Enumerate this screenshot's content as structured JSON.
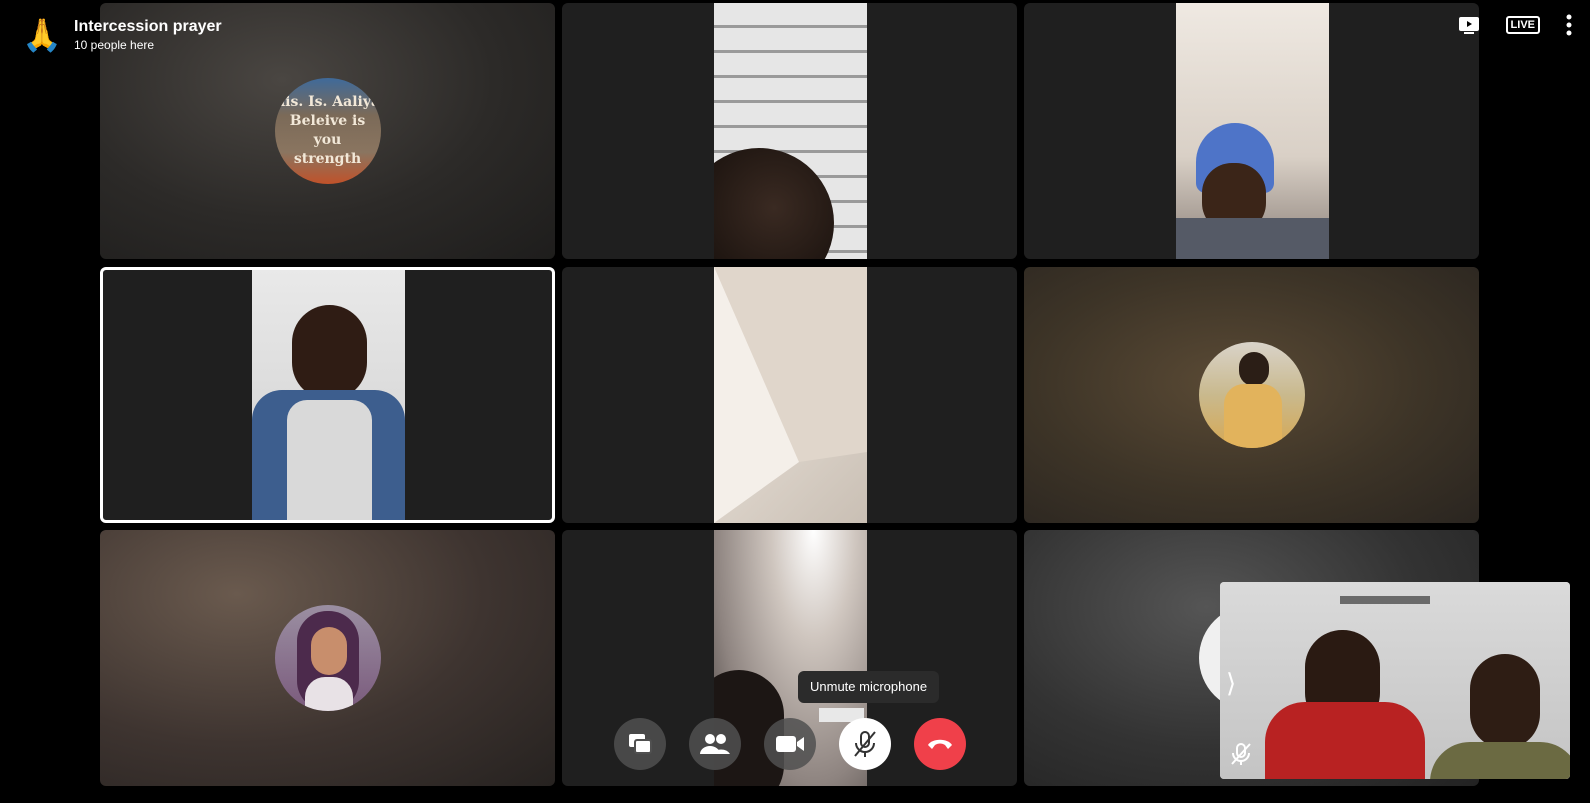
{
  "room": {
    "emoji": "🙏",
    "title": "Intercession prayer",
    "subtitle": "10 people here"
  },
  "top_bar": {
    "icons": [
      "present-icon",
      "live-icon",
      "more-icon"
    ],
    "live_label": "LIVE"
  },
  "tiles": [
    {
      "id": "tile-1",
      "type": "avatar",
      "avatar_text_lines": [
        "his. Is. Aaliya",
        "Beleive is you",
        "strength"
      ]
    },
    {
      "id": "tile-2",
      "type": "video"
    },
    {
      "id": "tile-3",
      "type": "video"
    },
    {
      "id": "tile-4",
      "type": "video",
      "active_speaker": true
    },
    {
      "id": "tile-5",
      "type": "video"
    },
    {
      "id": "tile-6",
      "type": "avatar"
    },
    {
      "id": "tile-7",
      "type": "avatar"
    },
    {
      "id": "tile-8",
      "type": "video"
    },
    {
      "id": "tile-9",
      "type": "avatar"
    }
  ],
  "self_view": {
    "expand_glyph": "⟩",
    "muted": true
  },
  "tooltip": {
    "text": "Unmute microphone"
  },
  "controls": [
    {
      "name": "screen-share-button",
      "icon": "screen-share-icon"
    },
    {
      "name": "participants-button",
      "icon": "people-icon"
    },
    {
      "name": "camera-button",
      "icon": "video-camera-icon"
    },
    {
      "name": "unmute-microphone-button",
      "icon": "microphone-muted-icon"
    },
    {
      "name": "end-call-button",
      "icon": "hang-up-icon"
    }
  ],
  "colors": {
    "background": "#000000",
    "end_call": "#f0404a",
    "tile": "#1f1f1f"
  }
}
